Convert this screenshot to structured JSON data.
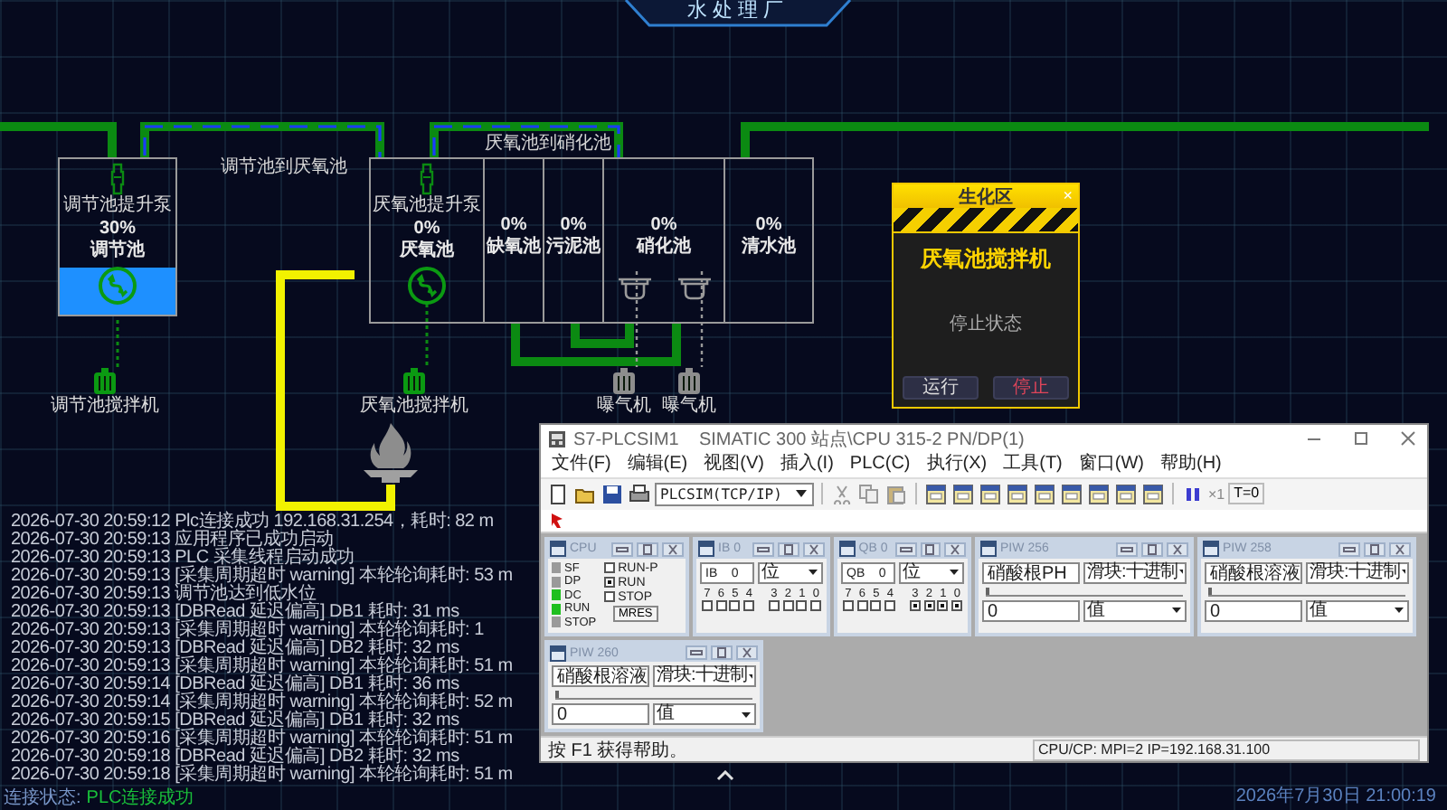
{
  "title": "水处理厂",
  "pipe_labels": [
    "调节池到厌氧池",
    "厌氧池到硝化池"
  ],
  "tanks": [
    {
      "name": "调节池",
      "level_text": "30%",
      "level": 0.3,
      "kind": "mixer",
      "pump": {
        "label": "调节池提升泵",
        "active": true
      },
      "mixer_active": true
    },
    {
      "name": "厌氧池",
      "level_text": "0%",
      "kind": "mixer",
      "pump": {
        "label": "厌氧池提升泵",
        "active": true
      },
      "mixer_active": true
    },
    {
      "name": "缺氧池",
      "level_text": "0%",
      "kind": "plain"
    },
    {
      "name": "污泥池",
      "level_text": "0%",
      "kind": "plain"
    },
    {
      "name": "硝化池",
      "level_text": "0%",
      "kind": "aeration"
    },
    {
      "name": "清水池",
      "level_text": "0%",
      "kind": "plain"
    }
  ],
  "motors": [
    {
      "label": "调节池搅拌机",
      "active": true
    },
    {
      "label": "厌氧池搅拌机",
      "active": true
    },
    {
      "label": "曝气机",
      "active": false
    },
    {
      "label": "曝气机",
      "active": false
    }
  ],
  "popup": {
    "title": "生化区",
    "close": "×",
    "device": "厌氧池搅拌机",
    "status": "停止状态",
    "buttons": [
      {
        "label": "运行",
        "kind": "run"
      },
      {
        "label": "停止",
        "kind": "stop"
      }
    ]
  },
  "log": [
    "2026-07-30 20:59:12 Plc连接成功 192.168.31.254，耗时: 82 m",
    "2026-07-30 20:59:13 应用程序已成功启动",
    "2026-07-30 20:59:13 PLC 采集线程启动成功",
    "2026-07-30 20:59:13 [采集周期超时 warning] 本轮轮询耗时: 53 m",
    "2026-07-30 20:59:13 调节池达到低水位",
    "2026-07-30 20:59:13 [DBRead 延迟偏高] DB1 耗时: 31 ms",
    "2026-07-30 20:59:13 [采集周期超时 warning] 本轮轮询耗时: 1",
    "2026-07-30 20:59:13 [DBRead 延迟偏高] DB2 耗时: 32 ms",
    "2026-07-30 20:59:13 [采集周期超时 warning] 本轮轮询耗时: 51 m",
    "2026-07-30 20:59:14 [DBRead 延迟偏高] DB1 耗时: 36 ms",
    "2026-07-30 20:59:14 [采集周期超时 warning] 本轮轮询耗时: 52 m",
    "2026-07-30 20:59:15 [DBRead 延迟偏高] DB1 耗时: 32 ms",
    "2026-07-30 20:59:16 [采集周期超时 warning] 本轮轮询耗时: 51 m",
    "2026-07-30 20:59:18 [DBRead 延迟偏高] DB2 耗时: 32 ms",
    "2026-07-30 20:59:18 [采集周期超时 warning] 本轮轮询耗时: 51 m"
  ],
  "plc": {
    "title": "S7-PLCSIM1    SIMATIC 300 站点\\CPU 315-2 PN/DP(1)",
    "menu": [
      "文件(F)",
      "编辑(E)",
      "视图(V)",
      "插入(I)",
      "PLC(C)",
      "执行(X)",
      "工具(T)",
      "窗口(W)",
      "帮助(H)"
    ],
    "interface": "PLCSIM(TCP/IP)",
    "scan_count": "×1",
    "timer_button": "T=0",
    "panels": [
      {
        "kind": "cpu",
        "title": "CPU",
        "leds": [
          {
            "label": "SF",
            "on": false
          },
          {
            "label": "DP",
            "on": false
          },
          {
            "label": "DC",
            "on": true
          },
          {
            "label": "RUN",
            "on": true
          },
          {
            "label": "STOP",
            "on": false
          }
        ],
        "modes": [
          {
            "label": "RUN-P",
            "checked": false
          },
          {
            "label": "RUN",
            "checked": true
          },
          {
            "label": "STOP",
            "checked": false
          }
        ],
        "button": "MRES"
      },
      {
        "kind": "bits",
        "title": "IB",
        "address": "0",
        "field": "IB    0",
        "format": "位",
        "bits": [
          {
            "label": "7",
            "checked": false
          },
          {
            "label": "6",
            "checked": false
          },
          {
            "label": "5",
            "checked": false
          },
          {
            "label": "4",
            "checked": false
          },
          {
            "label": "3",
            "checked": false
          },
          {
            "label": "2",
            "checked": false
          },
          {
            "label": "1",
            "checked": false
          },
          {
            "label": "0",
            "checked": false
          }
        ]
      },
      {
        "kind": "bits",
        "title": "QB",
        "address": "0",
        "field": "QB    0",
        "format": "位",
        "bits": [
          {
            "label": "7",
            "checked": false
          },
          {
            "label": "6",
            "checked": false
          },
          {
            "label": "5",
            "checked": false
          },
          {
            "label": "4",
            "checked": false
          },
          {
            "label": "3",
            "checked": true
          },
          {
            "label": "2",
            "checked": true
          },
          {
            "label": "1",
            "checked": true
          },
          {
            "label": "0",
            "checked": true
          }
        ]
      },
      {
        "kind": "slider",
        "title": "PIW",
        "address": "256",
        "field": "硝酸根PH",
        "format": "滑块:十进制",
        "level": 0,
        "value": "0",
        "value_format": "值"
      },
      {
        "kind": "slider",
        "title": "PIW",
        "address": "258",
        "field": "硝酸根溶液",
        "format": "滑块:十进制",
        "level": 0,
        "value": "0",
        "value_format": "值"
      },
      {
        "kind": "slider",
        "title": "PIW",
        "address": "260",
        "field": "硝酸根溶液",
        "format": "滑块:十进制",
        "level": 0,
        "value": "0",
        "value_format": "值"
      }
    ],
    "status_help": "按 F1 获得帮助。",
    "status_connection": "CPU/CP:  MPI=2 IP=192.168.31.100"
  },
  "connection": {
    "label": "连接状态:",
    "value": "PLC连接成功"
  },
  "datetime": "2026年7月30日 21:00:19"
}
